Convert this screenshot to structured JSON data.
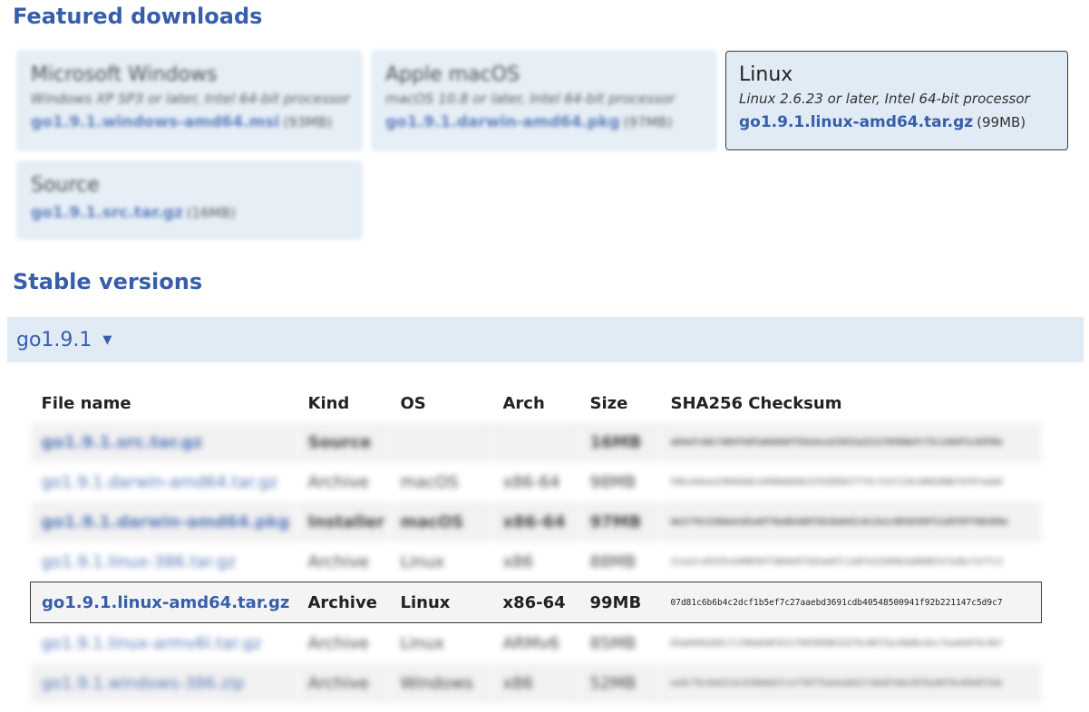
{
  "featured": {
    "heading": "Featured downloads",
    "cards": [
      {
        "platform": "Microsoft Windows",
        "reqs": "Windows XP SP3 or later, Intel 64-bit processor",
        "file": "go1.9.1.windows-amd64.msi",
        "size": "(93MB)"
      },
      {
        "platform": "Apple macOS",
        "reqs": "macOS 10.8 or later, Intel 64-bit processor",
        "file": "go1.9.1.darwin-amd64.pkg",
        "size": "(97MB)"
      },
      {
        "platform": "Linux",
        "reqs": "Linux 2.6.23 or later, Intel 64-bit processor",
        "file": "go1.9.1.linux-amd64.tar.gz",
        "size": "(99MB)"
      },
      {
        "platform": "Source",
        "file": "go1.9.1.src.tar.gz",
        "size": "(16MB)"
      }
    ]
  },
  "stable": {
    "heading": "Stable versions",
    "version": "go1.9.1",
    "caret": "▼"
  },
  "table": {
    "headers": [
      "File name",
      "Kind",
      "OS",
      "Arch",
      "Size",
      "SHA256 Checksum"
    ],
    "rows": [
      {
        "file": "go1.9.1.src.tar.gz",
        "kind": "Source",
        "os": "",
        "arch": "",
        "size": "16MB",
        "sha": "a84afc9dc7d64fe0fa84d4d735e2ece23831a22117b50dafc75c1484f1cb550e"
      },
      {
        "file": "go1.9.1.darwin-amd64.tar.gz",
        "kind": "Archive",
        "os": "macOS",
        "arch": "x86-64",
        "size": "98MB",
        "sha": "59bc6deee2969dddc4490b684b15f63058177f5c7e27134c060288b7d76faab0"
      },
      {
        "file": "go1.9.1.darwin-amd64.pkg",
        "kind": "Installer",
        "os": "macOS",
        "arch": "x86-64",
        "size": "97MB",
        "sha": "de1779c5366ee3d1e8f7be8b3d6f3b18eb42c0c2e1c8038399f11d5f8ff6b360a"
      },
      {
        "file": "go1.9.1.linux-386.tar.gz",
        "kind": "Archive",
        "os": "Linux",
        "arch": "x86",
        "size": "88MB",
        "sha": "2cea1ce9325cb40839ffdb9e0f2d2ae6fc1a0fe22d45b3a09d6fe7a3bcfe7fc2"
      },
      {
        "file": "go1.9.1.linux-amd64.tar.gz",
        "kind": "Archive",
        "os": "Linux",
        "arch": "x86-64",
        "size": "99MB",
        "sha": "07d81c6b6b4c2dcf1b5ef7c27aaebd3691cdb40548500941f92b221147c5d9c7"
      },
      {
        "file": "go1.9.1.linux-armv6l.tar.gz",
        "kind": "Archive",
        "os": "Linux",
        "arch": "ARMv6",
        "size": "85MB",
        "sha": "65a0495a50c7c240a6487b1170939586332f6c86f3ac0dd6c6ec7ea4e0fdc4bf"
      },
      {
        "file": "go1.9.1.windows-386.zip",
        "kind": "Archive",
        "os": "Windows",
        "arch": "x86",
        "size": "52MB",
        "sha": "ea9c79c9e6214c9398dd27ce7f8f75a4ea9d17c8e8fe0e28f6a9d79c05b8f2de"
      }
    ]
  }
}
